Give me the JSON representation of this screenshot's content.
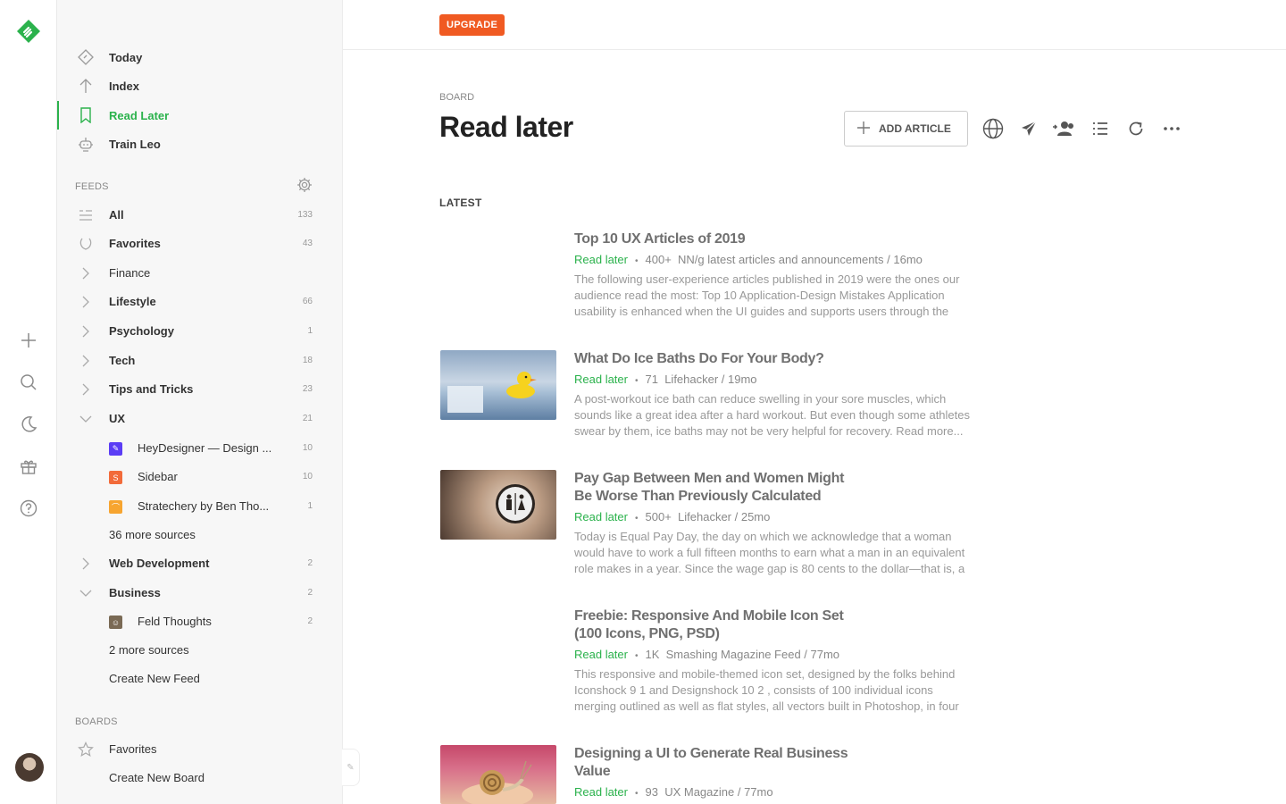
{
  "colors": {
    "accent": "#2bb24c",
    "upgrade": "#f05a22"
  },
  "rail": {
    "icons": [
      "feedly-logo-icon",
      "plus-icon",
      "search-icon",
      "moon-icon",
      "gift-icon",
      "help-icon",
      "avatar"
    ]
  },
  "sidebar": {
    "nav": [
      {
        "label": "Today",
        "icon": "today-icon"
      },
      {
        "label": "Index",
        "icon": "arrow-up-icon"
      },
      {
        "label": "Read Later",
        "icon": "bookmark-icon"
      },
      {
        "label": "Train Leo",
        "icon": "robot-icon"
      }
    ],
    "feeds_label": "FEEDS",
    "feeds": [
      {
        "label": "All",
        "count": "133"
      },
      {
        "label": "Favorites",
        "count": "43"
      },
      {
        "label": "Finance",
        "count": ""
      },
      {
        "label": "Lifestyle",
        "count": "66"
      },
      {
        "label": "Psychology",
        "count": "1"
      },
      {
        "label": "Tech",
        "count": "18"
      },
      {
        "label": "Tips and Tricks",
        "count": "23"
      },
      {
        "label": "UX",
        "count": "21"
      },
      {
        "label": "HeyDesigner — Design ...",
        "count": "10"
      },
      {
        "label": "Sidebar",
        "count": "10"
      },
      {
        "label": "Stratechery by Ben Tho...",
        "count": "1"
      },
      {
        "label": "36 more sources",
        "count": ""
      },
      {
        "label": "Web Development",
        "count": "2"
      },
      {
        "label": "Business",
        "count": "2"
      },
      {
        "label": "Feld Thoughts",
        "count": "2"
      },
      {
        "label": "2 more sources",
        "count": ""
      },
      {
        "label": "Create New Feed",
        "count": ""
      }
    ],
    "boards_label": "BOARDS",
    "boards": [
      {
        "label": "Favorites"
      },
      {
        "label": "Create New Board"
      }
    ]
  },
  "topbar": {
    "upgrade_label": "UPGRADE"
  },
  "main": {
    "kicker": "BOARD",
    "title": "Read later",
    "add_article_label": "ADD ARTICLE",
    "latest_label": "LATEST",
    "articles": [
      {
        "title": "Top 10 UX Articles of 2019",
        "tag": "Read later",
        "count": "400+",
        "source": "NN/g latest articles and announcements / 16mo",
        "summary": "The following user-experience articles published in 2019 were the ones our audience read the most: Top 10 Application-Design Mistakes Application usability is enhanced when the UI guides and supports users through the"
      },
      {
        "title": "What Do Ice Baths Do For Your Body?",
        "tag": "Read later",
        "count": "71",
        "source": "Lifehacker / 19mo",
        "summary": "A post-workout ice bath can reduce swelling in your sore muscles, which sounds like a great idea after a hard workout. But even though some athletes swear by them, ice baths may not be very helpful for recovery. Read more..."
      },
      {
        "title": "Pay Gap Between Men and Women Might Be Worse Than Previously Calculated",
        "tag": "Read later",
        "count": "500+",
        "source": "Lifehacker / 25mo",
        "summary": "Today is Equal Pay Day, the day on which we acknowledge that a woman would have to work a full fifteen months to earn what a man in an equivalent role makes in a year. Since the wage gap is 80 cents to the dollar—that is, a"
      },
      {
        "title": "Freebie: Responsive And Mobile Icon Set (100 Icons, PNG, PSD)",
        "tag": "Read later",
        "count": "1K",
        "source": "Smashing Magazine Feed / 77mo",
        "summary": "This responsive and mobile-themed icon set, designed by the folks behind Iconshock 9 1 and Designshock 10 2 , consists of 100 individual icons merging outlined as well as flat styles, all vectors built in Photoshop, in four"
      },
      {
        "title": "Designing a UI to Generate Real Business Value",
        "tag": "Read later",
        "count": "93",
        "source": "UX Magazine / 77mo",
        "summary": ""
      }
    ]
  }
}
